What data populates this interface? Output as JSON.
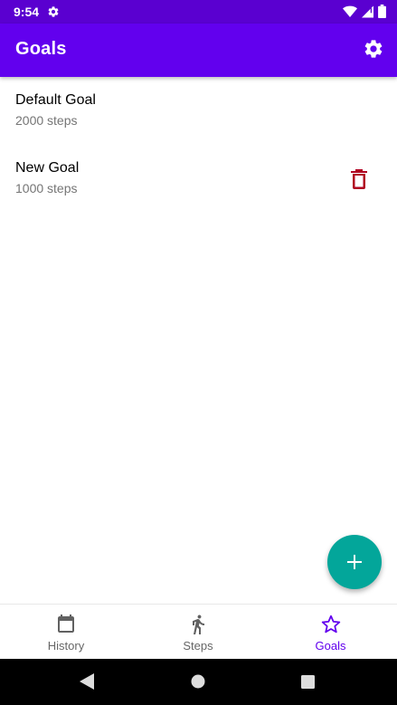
{
  "status_bar": {
    "time": "9:54",
    "icons": [
      "gear-icon",
      "wifi-icon",
      "signal-icon",
      "battery-icon"
    ]
  },
  "app_bar": {
    "title": "Goals",
    "settings_icon": "gear-icon"
  },
  "goals": [
    {
      "name": "Default Goal",
      "steps": "2000 steps",
      "deletable": false
    },
    {
      "name": "New Goal",
      "steps": "1000 steps",
      "deletable": true
    }
  ],
  "fab": {
    "icon": "plus-icon",
    "color": "#03a69a"
  },
  "bottom_nav": {
    "items": [
      {
        "label": "History",
        "icon": "calendar-icon",
        "active": false
      },
      {
        "label": "Steps",
        "icon": "walking-icon",
        "active": false
      },
      {
        "label": "Goals",
        "icon": "star-icon",
        "active": true
      }
    ]
  },
  "colors": {
    "primary": "#6200ee",
    "status_bar": "#5a00d0",
    "accent": "#03a69a",
    "delete": "#b00020"
  },
  "system_nav": [
    "back-icon",
    "home-icon",
    "recents-icon"
  ]
}
